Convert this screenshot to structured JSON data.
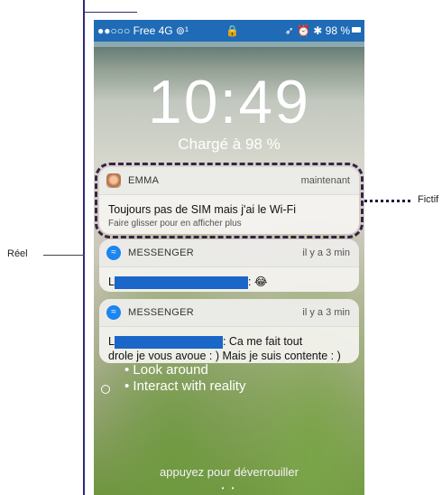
{
  "annotations": {
    "reel": "Réel",
    "fictif": "Fictif"
  },
  "statusbar": {
    "left": "●●○○○ Free  4G  ⊚¹",
    "lock": "🔒",
    "right": "➶ ⏰ ✱ 98 %"
  },
  "lockscreen": {
    "time": "10:49",
    "charge": "Chargé à 98 %",
    "bullets": [
      "• Look around",
      "• Interact with reality"
    ],
    "unlock": "appuyez pour déverrouiller",
    "page_dots": "• •"
  },
  "notifications": [
    {
      "app": "EMMA",
      "time": "maintenant",
      "title": "Toujours pas de SIM mais j'ai le Wi-Fi",
      "subtitle": "Faire glisser pour en afficher plus",
      "icon": "avatar-icon"
    },
    {
      "app": "MESSENGER",
      "time": "il y a 3 min",
      "prefix": "L",
      "suffix": ": 😂",
      "icon": "messenger-icon"
    },
    {
      "app": "MESSENGER",
      "time": "il y a 3 min",
      "prefix": "L",
      "suffix": ": Ca me fait tout",
      "line2": "drole je vous avoue  : ) Mais je suis contente  : )",
      "icon": "messenger-icon"
    }
  ],
  "colors": {
    "statusbar": "#1f6bb5",
    "redaction": "#1a67c9",
    "annotation": "#2c2a78"
  }
}
